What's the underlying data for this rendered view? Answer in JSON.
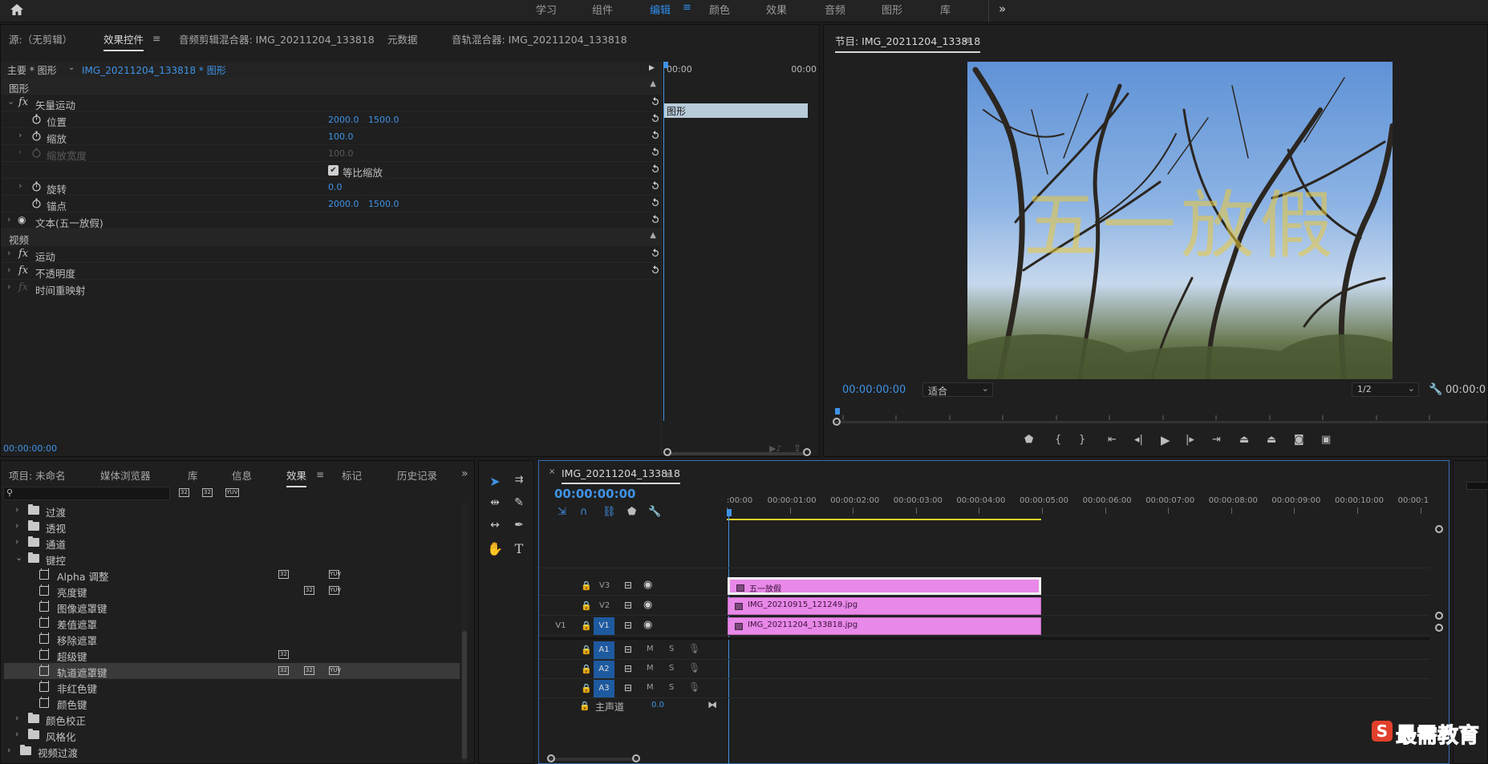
{
  "topbar": {
    "workspaces": [
      "学习",
      "组件",
      "编辑",
      "颜色",
      "效果",
      "音频",
      "图形",
      "库"
    ],
    "active": "编辑",
    "more": "»"
  },
  "source_panel": {
    "tabs": [
      "源:（无剪辑）",
      "效果控件",
      "音频剪辑混合器: IMG_20211204_133818",
      "元数据",
      "音轨混合器: IMG_20211204_133818"
    ],
    "active_tab": "效果控件",
    "clip_selector": "主要 * 图形",
    "clip_name": "IMG_20211204_133818 * 图形",
    "timecode_start": "00:00",
    "timecode_end": "00:00",
    "mini_clip_label": "图形",
    "footer_timecode": "00:00:00:00",
    "sections": {
      "graphics": "图形",
      "video": "视频"
    },
    "rows": {
      "vector_motion": "矢量运动",
      "position": "位置",
      "position_x": "2000.0",
      "position_y": "1500.0",
      "scale": "缩放",
      "scale_val": "100.0",
      "scale_width": "缩放宽度",
      "scale_width_val": "100.0",
      "uniform_scale": "等比缩放",
      "rotation": "旋转",
      "rotation_val": "0.0",
      "anchor": "锚点",
      "anchor_x": "2000.0",
      "anchor_y": "1500.0",
      "text_layer": "文本(五一放假)",
      "motion": "运动",
      "opacity": "不透明度",
      "time_remap": "时间重映射"
    }
  },
  "program_panel": {
    "title": "节目: IMG_20211204_133818",
    "overlay_text": "五一放假",
    "timecode": "00:00:00:00",
    "fit": "适合",
    "resolution": "1/2",
    "right_timecode": "00:00:0"
  },
  "project_panel": {
    "tabs": [
      "项目: 未命名",
      "媒体浏览器",
      "库",
      "信息",
      "效果",
      "标记",
      "历史记录"
    ],
    "active_tab": "效果",
    "search_placeholder": "",
    "tree": [
      {
        "label": "过渡",
        "type": "folder",
        "level": 1,
        "open": false
      },
      {
        "label": "透视",
        "type": "folder",
        "level": 1,
        "open": false
      },
      {
        "label": "通道",
        "type": "folder",
        "level": 1,
        "open": false
      },
      {
        "label": "键控",
        "type": "folder",
        "level": 1,
        "open": true
      },
      {
        "label": "Alpha 调整",
        "type": "effect",
        "level": 2,
        "badges": [
          1,
          3
        ]
      },
      {
        "label": "亮度键",
        "type": "effect",
        "level": 2,
        "badges": [
          2,
          3
        ]
      },
      {
        "label": "图像遮罩键",
        "type": "effect",
        "level": 2,
        "badges": []
      },
      {
        "label": "差值遮罩",
        "type": "effect",
        "level": 2,
        "badges": []
      },
      {
        "label": "移除遮罩",
        "type": "effect",
        "level": 2,
        "badges": []
      },
      {
        "label": "超级键",
        "type": "effect",
        "level": 2,
        "badges": [
          1
        ]
      },
      {
        "label": "轨道遮罩键",
        "type": "effect",
        "level": 2,
        "badges": [
          1,
          2,
          3
        ],
        "selected": true
      },
      {
        "label": "非红色键",
        "type": "effect",
        "level": 2,
        "badges": []
      },
      {
        "label": "颜色键",
        "type": "effect",
        "level": 2,
        "badges": []
      },
      {
        "label": "颜色校正",
        "type": "folder",
        "level": 1,
        "open": false
      },
      {
        "label": "风格化",
        "type": "folder",
        "level": 1,
        "open": false
      },
      {
        "label": "视频过渡",
        "type": "folder",
        "level": 0,
        "open": false
      }
    ],
    "badge_labels": [
      "32",
      "32",
      "YUV"
    ]
  },
  "timeline": {
    "sequence_name": "IMG_20211204_133818",
    "timecode": "00:00:00:00",
    "ruler": [
      ":00:00",
      "00:00:01:00",
      "00:00:02:00",
      "00:00:03:00",
      "00:00:04:00",
      "00:00:05:00",
      "00:00:06:00",
      "00:00:07:00",
      "00:00:08:00",
      "00:00:09:00",
      "00:00:10:00",
      "00:00:1"
    ],
    "video_tracks": [
      {
        "name": "V3",
        "clip": "五一放假"
      },
      {
        "name": "V2",
        "clip": "IMG_20210915_121249.jpg"
      },
      {
        "name": "V1",
        "clip": "IMG_20211204_133818.jpg",
        "source": "V1"
      }
    ],
    "audio_tracks": [
      "A1",
      "A2",
      "A3"
    ],
    "mute": "M",
    "solo": "S",
    "master": "主声道",
    "master_val": "0.0"
  },
  "watermark": "最需教育",
  "colors": {
    "accent": "#2d8ceb",
    "clip": "#e888e8",
    "track_btn": "#1e5aa0"
  }
}
